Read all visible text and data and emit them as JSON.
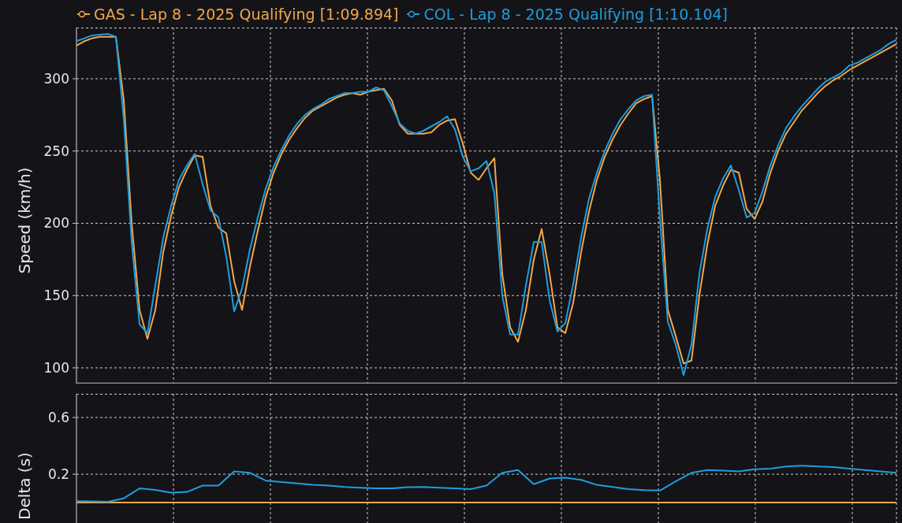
{
  "speed_chart": {
    "chart_data": {
      "type": "line",
      "grid": true,
      "legend": true,
      "ylabel": "Speed (km/h)",
      "ylim": [
        89.1,
        335.4
      ],
      "yticks": [
        100,
        150,
        200,
        250,
        300
      ],
      "categories": [
        null,
        null,
        null,
        null,
        null,
        null,
        null,
        null,
        null,
        null,
        null,
        null,
        null,
        null,
        null,
        null,
        null,
        null,
        null,
        null,
        null,
        null,
        null,
        null,
        null,
        null,
        null,
        null,
        null,
        null,
        null,
        null,
        null,
        null,
        null,
        null,
        null,
        null,
        null,
        null,
        null,
        null,
        null,
        null,
        null,
        null,
        null,
        null,
        null,
        null,
        null,
        null,
        null,
        null,
        null,
        null,
        null,
        null,
        null,
        null,
        null,
        null,
        null,
        null,
        null,
        null,
        null,
        null,
        null,
        null,
        null,
        null,
        null,
        null,
        null,
        null,
        null,
        null,
        null,
        null,
        null,
        null,
        null,
        null,
        null,
        null,
        null,
        null,
        null,
        null,
        null,
        null,
        null,
        null,
        null,
        null,
        null,
        null,
        null,
        null,
        null,
        null,
        null,
        null,
        null
      ],
      "series": [
        {
          "name": "GAS - Lap 8 - 2025 Qualifying [1:09.894]",
          "color": "#f0a848",
          "values": [
            323,
            326,
            328,
            329,
            329,
            329,
            285,
            200,
            140,
            120,
            140,
            180,
            205,
            225,
            237,
            247,
            246,
            212,
            197,
            193,
            160,
            140,
            170,
            195,
            218,
            235,
            248,
            258,
            266,
            273,
            278,
            281,
            284,
            287,
            289,
            290,
            289,
            291,
            292,
            293,
            285,
            268,
            262,
            262,
            262,
            263,
            268,
            271,
            272,
            255,
            235,
            230,
            238,
            245,
            165,
            128,
            118,
            140,
            175,
            196,
            165,
            128,
            124,
            145,
            180,
            208,
            230,
            246,
            258,
            268,
            276,
            283,
            286,
            288,
            230,
            140,
            122,
            103,
            105,
            150,
            185,
            212,
            226,
            237,
            235,
            210,
            203,
            215,
            235,
            250,
            262,
            270,
            278,
            284,
            290,
            295,
            299,
            302,
            306,
            309,
            312,
            315,
            318,
            321,
            324
          ]
        },
        {
          "name": "COL - Lap 8 - 2025 Qualifying [1:10.104]",
          "color": "#1e9ede",
          "values": [
            326,
            328,
            330,
            330.5,
            331,
            329,
            272,
            187,
            130,
            124,
            157,
            190,
            212,
            230,
            240,
            248,
            227,
            209,
            204,
            177,
            139,
            155,
            182,
            204,
            224,
            239,
            251,
            261,
            269,
            275,
            279,
            282,
            286,
            288,
            290,
            290,
            291,
            291,
            294,
            292,
            281,
            269,
            264,
            262,
            264,
            267,
            270,
            274,
            265,
            246,
            236,
            238,
            243,
            221,
            150,
            123,
            123,
            157,
            187,
            187,
            147,
            125,
            131,
            158,
            190,
            217,
            235,
            250,
            262,
            272,
            279,
            285,
            288,
            289,
            203,
            132,
            116,
            95,
            116,
            165,
            196,
            218,
            231,
            240,
            223,
            204,
            207,
            222,
            240,
            254,
            266,
            274,
            281,
            287,
            293,
            298,
            301,
            304,
            309,
            311,
            314,
            317,
            320,
            324,
            327
          ]
        }
      ]
    }
  },
  "delta_chart": {
    "chart_data": {
      "type": "line",
      "grid": true,
      "ylabel": "Delta (s)",
      "ylim": [
        -0.144,
        0.767
      ],
      "yticks": [
        0.2,
        0.6
      ],
      "categories": [
        null,
        null,
        null,
        null,
        null,
        null,
        null,
        null,
        null,
        null,
        null,
        null,
        null,
        null,
        null,
        null,
        null,
        null,
        null,
        null,
        null,
        null,
        null,
        null,
        null,
        null,
        null,
        null,
        null,
        null,
        null,
        null,
        null,
        null,
        null,
        null,
        null,
        null,
        null,
        null,
        null,
        null,
        null,
        null,
        null,
        null,
        null,
        null,
        null,
        null,
        null,
        null,
        null
      ],
      "series": [
        {
          "color": "#f0a848",
          "values": [
            0,
            0,
            0,
            0,
            0,
            0,
            0,
            0,
            0,
            0,
            0,
            0,
            0,
            0,
            0,
            0,
            0,
            0,
            0,
            0,
            0,
            0,
            0,
            0,
            0,
            0,
            0,
            0,
            0,
            0,
            0,
            0,
            0,
            0,
            0,
            0,
            0,
            0,
            0,
            0,
            0,
            0,
            0,
            0,
            0,
            0,
            0,
            0,
            0,
            0,
            0,
            0,
            0
          ]
        },
        {
          "color": "#1e9ede",
          "values": [
            0.01,
            0.008,
            0.006,
            0.03,
            0.1,
            0.09,
            0.07,
            0.075,
            0.12,
            0.12,
            0.22,
            0.21,
            0.155,
            0.145,
            0.135,
            0.125,
            0.12,
            0.11,
            0.105,
            0.1,
            0.1,
            0.108,
            0.11,
            0.105,
            0.1,
            0.095,
            0.12,
            0.21,
            0.23,
            0.13,
            0.17,
            0.175,
            0.16,
            0.125,
            0.11,
            0.095,
            0.088,
            0.085,
            0.15,
            0.21,
            0.23,
            0.225,
            0.22,
            0.235,
            0.24,
            0.255,
            0.26,
            0.255,
            0.25,
            0.24,
            0.23,
            0.22,
            0.21
          ]
        }
      ]
    }
  }
}
